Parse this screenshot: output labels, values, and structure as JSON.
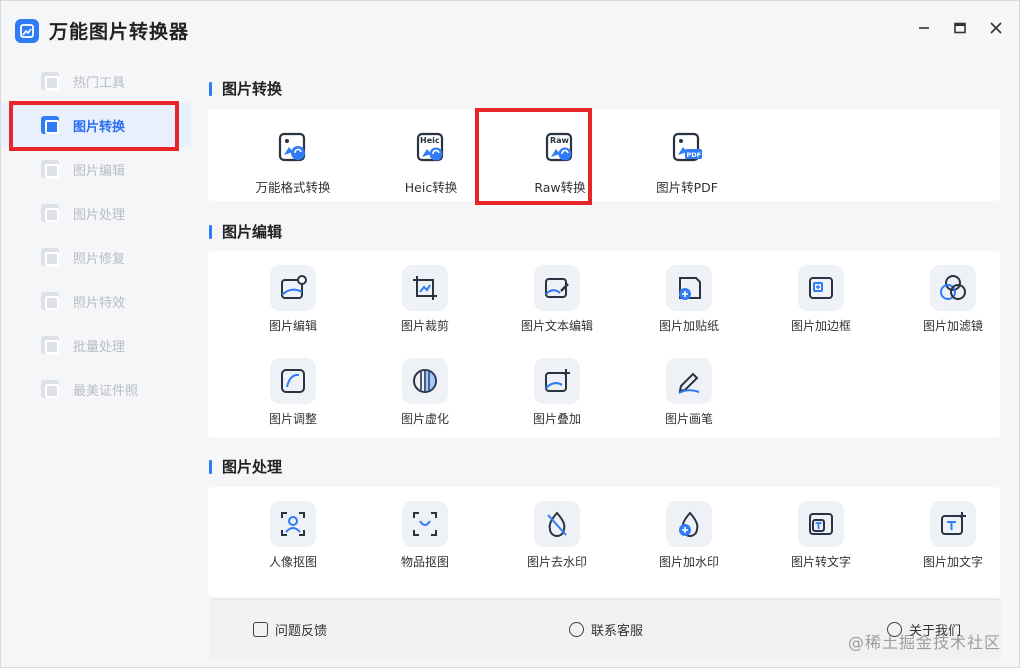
{
  "app": {
    "title": "万能图片转换器"
  },
  "sidebar": {
    "items": [
      {
        "label": "热门工具",
        "icon": "grid-icon"
      },
      {
        "label": "图片转换",
        "icon": "image-convert-icon",
        "active": true
      },
      {
        "label": "图片编辑",
        "icon": "image-edit-icon"
      },
      {
        "label": "图片处理",
        "icon": "image-process-icon"
      },
      {
        "label": "照片修复",
        "icon": "photo-repair-icon"
      },
      {
        "label": "照片特效",
        "icon": "photo-effect-icon"
      },
      {
        "label": "批量处理",
        "icon": "batch-icon"
      },
      {
        "label": "最美证件照",
        "icon": "id-photo-icon"
      }
    ]
  },
  "sections": {
    "convert": {
      "title": "图片转换",
      "tools": [
        {
          "label": "万能格式转换",
          "icon": "format-convert-icon"
        },
        {
          "label": "Heic转换",
          "icon": "heic-icon",
          "badge": "Heic"
        },
        {
          "label": "Raw转换",
          "icon": "raw-icon",
          "badge": "Raw"
        },
        {
          "label": "图片转PDF",
          "icon": "pdf-icon",
          "badge": "PDF"
        }
      ]
    },
    "edit": {
      "title": "图片编辑",
      "tools": [
        {
          "label": "图片编辑",
          "icon": "image-settings-icon"
        },
        {
          "label": "图片裁剪",
          "icon": "crop-icon"
        },
        {
          "label": "图片文本编辑",
          "icon": "text-edit-icon"
        },
        {
          "label": "图片加贴纸",
          "icon": "sticker-icon"
        },
        {
          "label": "图片加边框",
          "icon": "border-icon"
        },
        {
          "label": "图片加滤镜",
          "icon": "filter-icon"
        },
        {
          "label": "图片调整",
          "icon": "adjust-icon"
        },
        {
          "label": "图片虚化",
          "icon": "blur-icon"
        },
        {
          "label": "图片叠加",
          "icon": "overlay-icon"
        },
        {
          "label": "图片画笔",
          "icon": "brush-icon"
        }
      ]
    },
    "process": {
      "title": "图片处理",
      "tools": [
        {
          "label": "人像抠图",
          "icon": "portrait-cutout-icon"
        },
        {
          "label": "物品抠图",
          "icon": "object-cutout-icon"
        },
        {
          "label": "图片去水印",
          "icon": "remove-watermark-icon"
        },
        {
          "label": "图片加水印",
          "icon": "add-watermark-icon"
        },
        {
          "label": "图片转文字",
          "icon": "image-to-text-icon"
        },
        {
          "label": "图片加文字",
          "icon": "add-text-icon"
        }
      ]
    }
  },
  "footer": {
    "feedback": "问题反馈",
    "support": "联系客服",
    "about": "关于我们"
  },
  "watermark": "@稀土掘金技术社区",
  "colors": {
    "accent": "#2f7cf6",
    "highlight": "#e8262a"
  }
}
